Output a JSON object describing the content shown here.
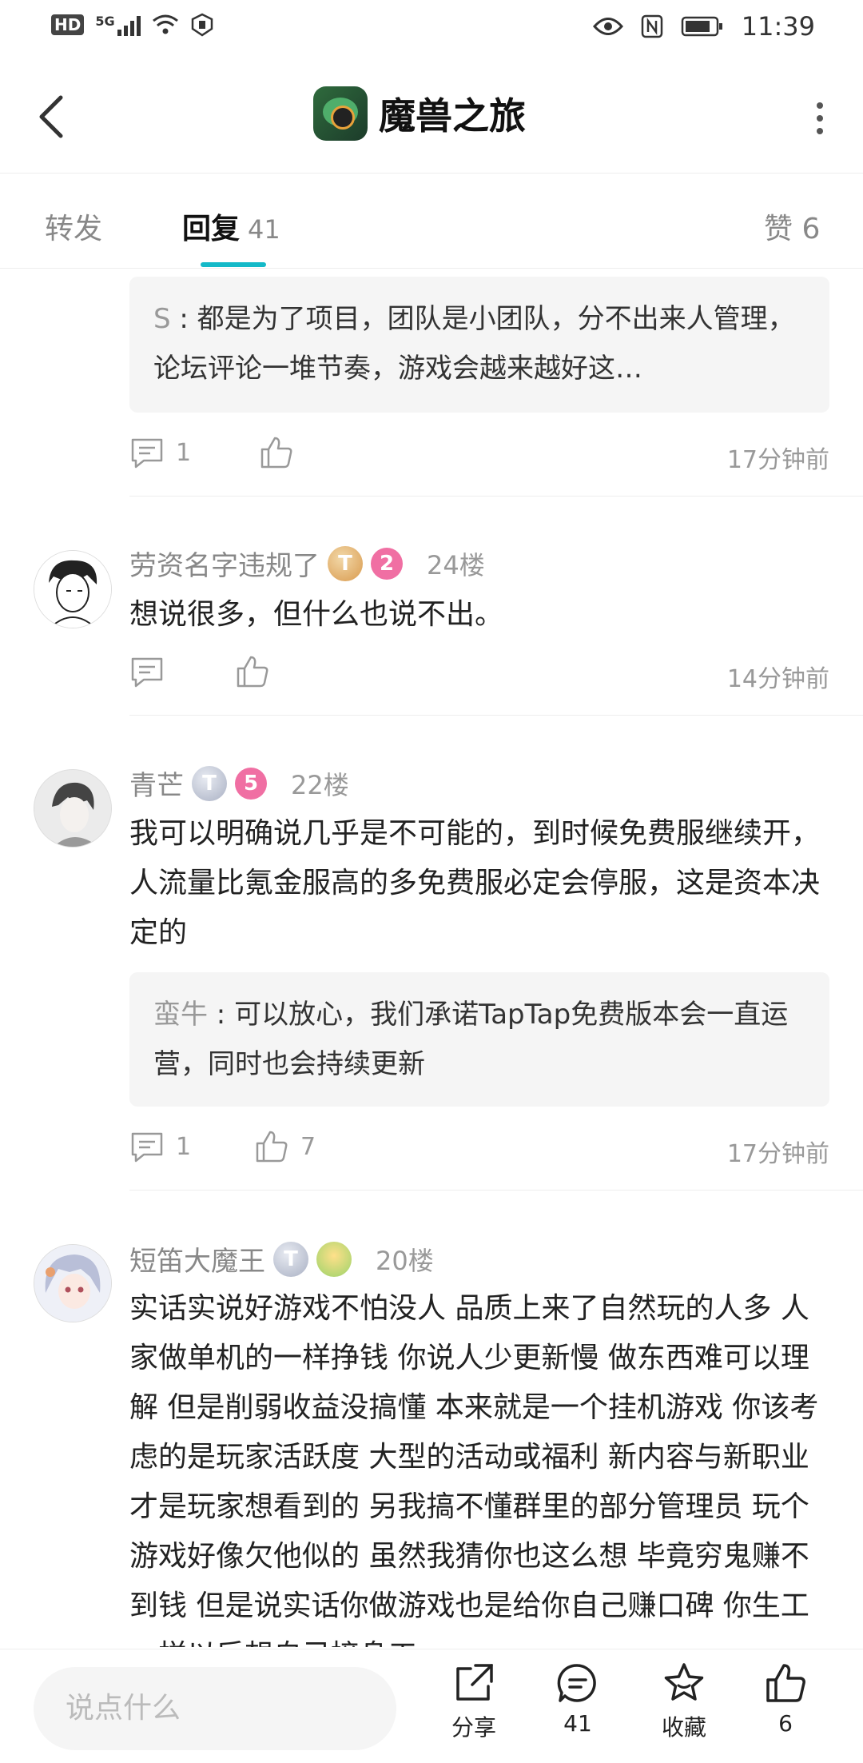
{
  "status_bar": {
    "network": "HD",
    "signal": "5G",
    "time": "11:39"
  },
  "header": {
    "game_name": "魔兽之旅"
  },
  "tabs": {
    "forward": "转发",
    "reply": "回复",
    "reply_count": "41",
    "like": "赞",
    "like_count": "6"
  },
  "replies": [
    {
      "quote_name": "S",
      "quote_sep": " : ",
      "quote_text": "都是为了项目，团队是小团队，分不出来人管理，论坛评论一堆节奏，游戏会越来越好这…",
      "comment_count": "1",
      "time": "17分钟前"
    },
    {
      "username": "劳资名字违规了",
      "level_badge": "T",
      "number_badge": "2",
      "floor": "24楼",
      "text": "想说很多，但什么也说不出。",
      "comment_count": "",
      "time": "14分钟前"
    },
    {
      "username": "青芒",
      "level_badge": "T",
      "number_badge": "5",
      "floor": "22楼",
      "text": "我可以明确说几乎是不可能的，到时候免费服继续开，人流量比氪金服高的多免费服必定会停服，这是资本决定的",
      "quote_name": "蛮牛",
      "quote_sep": " : ",
      "quote_text": "可以放心，我们承诺TapTap免费版本会一直运营，同时也会持续更新",
      "comment_count": "1",
      "like_count": "7",
      "time": "17分钟前"
    },
    {
      "username": "短笛大魔王",
      "level_badge": "T",
      "floor": "20楼",
      "text": "实话实说好游戏不怕没人  品质上来了自然玩的人多  人家做单机的一样挣钱  你说人少更新慢 做东西难可以理解  但是削弱收益没搞懂  本来就是一个挂机游戏 你该考虑的是玩家活跃度  大型的活动或福利  新内容与新职业才是玩家想看到的  另我搞不懂群里的部分管理员 玩个游戏好像欠他似的 虽然我猜你也这么想 毕竟穷鬼赚不到钱 但是说实话你做游戏也是给你自己赚口碑 你生工一样以后想自己接身工"
    }
  ],
  "bottom_bar": {
    "placeholder": "说点什么",
    "share_label": "分享",
    "comment_count": "41",
    "favorite_label": "收藏",
    "like_count": "6"
  }
}
